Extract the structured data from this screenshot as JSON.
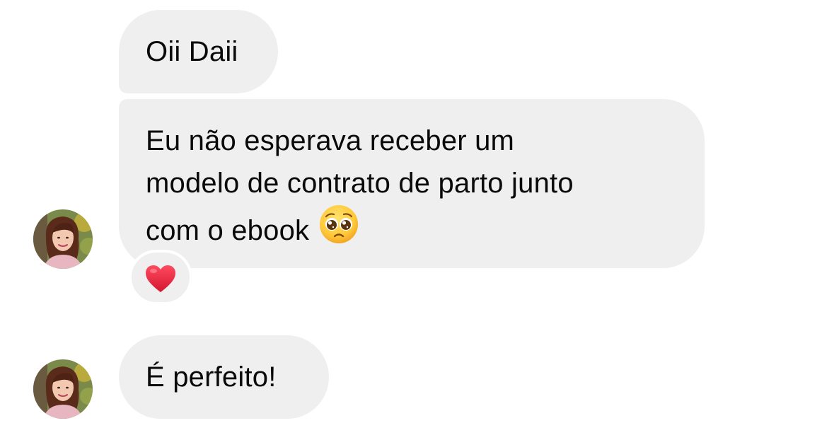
{
  "conversation": {
    "messages": [
      {
        "lines": [
          "Oii Daii"
        ]
      },
      {
        "lines": [
          "Eu não esperava receber um",
          "modelo de contrato de parto junto",
          "com o ebook"
        ],
        "emoji": "pleading-face",
        "reaction": "red-heart"
      },
      {
        "lines": [
          "É perfeito!"
        ]
      }
    ]
  },
  "colors": {
    "bubble_bg": "#efefef",
    "text": "#0a0a0a",
    "heart": "#e0243b"
  }
}
